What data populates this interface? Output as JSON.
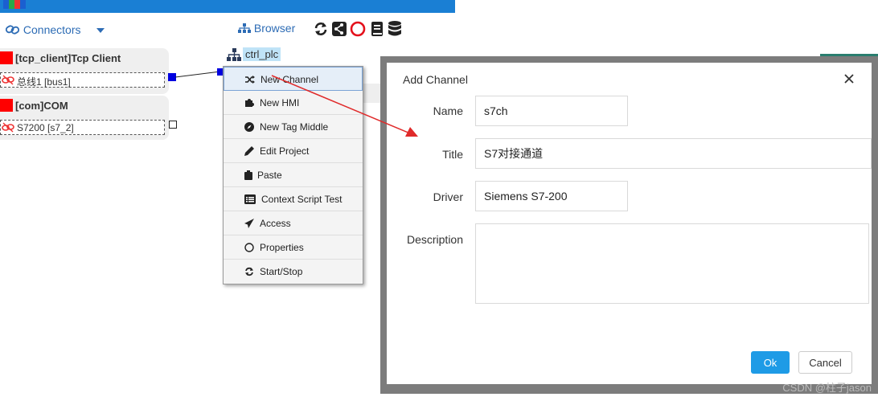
{
  "toolbar": {
    "connectors_label": "Connectors",
    "browser_label": "Browser"
  },
  "connectors": [
    {
      "title": "[tcp_client]Tcp Client",
      "sub": "总线1 [bus1]"
    },
    {
      "title": "[com]COM",
      "sub": "S7200 [s7_2]"
    }
  ],
  "node": {
    "label": "ctrl_plc"
  },
  "menu": {
    "items": [
      {
        "label": "New Channel",
        "icon": "shuffle-icon"
      },
      {
        "label": "New HMI",
        "icon": "puzzle-icon"
      },
      {
        "label": "New Tag Middle",
        "icon": "compass-icon"
      },
      {
        "label": "Edit Project",
        "icon": "pencil-icon"
      },
      {
        "label": "Paste",
        "icon": "clipboard-icon"
      },
      {
        "label": "Context Script Test",
        "icon": "list-icon"
      },
      {
        "label": "Access",
        "icon": "send-icon"
      },
      {
        "label": "Properties",
        "icon": "circle-icon"
      },
      {
        "label": "Start/Stop",
        "icon": "refresh-icon"
      }
    ]
  },
  "dialog": {
    "title": "Add Channel",
    "fields": {
      "name": {
        "label": "Name",
        "value": "s7ch"
      },
      "title": {
        "label": "Title",
        "value": "S7对接通道"
      },
      "driver": {
        "label": "Driver",
        "value": "Siemens S7-200"
      },
      "description": {
        "label": "Description",
        "value": ""
      }
    },
    "ok_label": "Ok",
    "cancel_label": "Cancel"
  },
  "watermark": "CSDN @柱子jason",
  "colors": {
    "header": "#1a7fd4",
    "link": "#2d6cb5",
    "ok": "#1e9be6",
    "arrow": "#e02a2a",
    "node_highlight": "#bfe3f7"
  }
}
